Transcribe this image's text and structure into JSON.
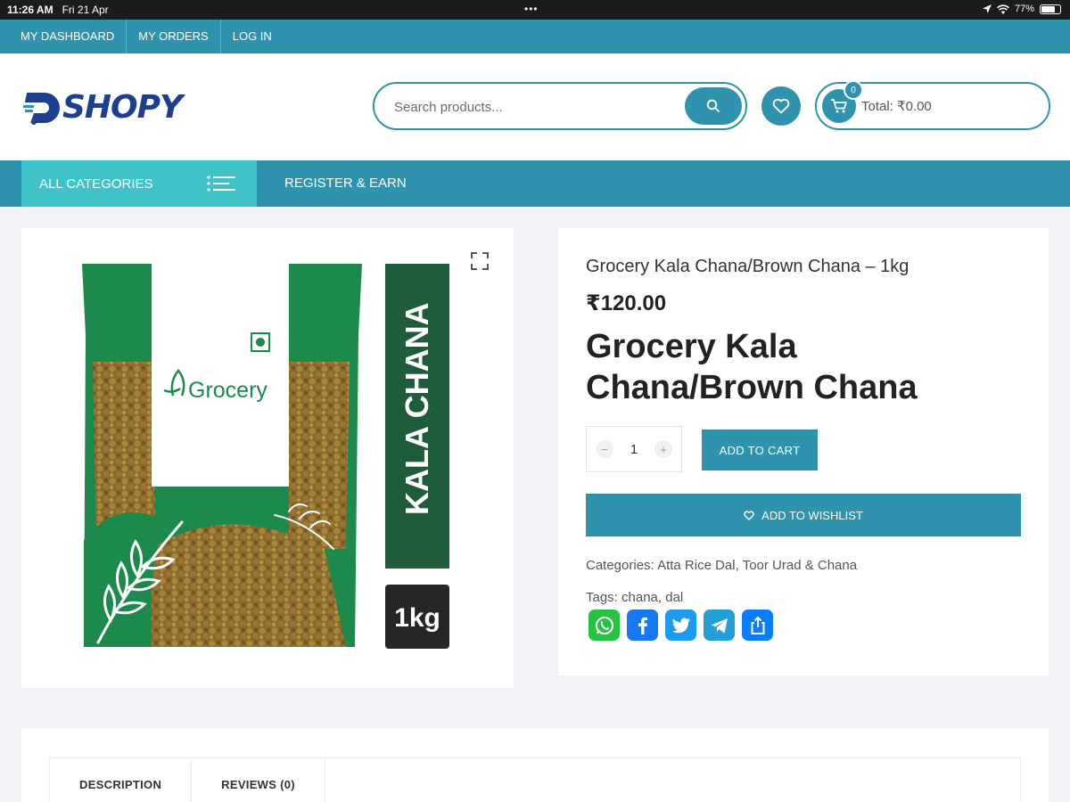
{
  "status_bar": {
    "time": "11:26 AM",
    "date": "Fri 21 Apr",
    "battery": "77%",
    "battery_level": 0.77,
    "dots": "•••"
  },
  "top_links": [
    "MY DASHBOARD",
    "MY ORDERS",
    "LOG IN"
  ],
  "brand": {
    "name": "SHOPY",
    "color": "#1e3f8f"
  },
  "search": {
    "placeholder": "Search products..."
  },
  "cart": {
    "count": "0",
    "total": "Total: ₹0.00"
  },
  "nav": {
    "all_categories": "ALL CATEGORIES",
    "register": "REGISTER & EARN"
  },
  "product_image": {
    "brand": "Grocery",
    "side_label": "KALA CHANA",
    "weight": "1kg"
  },
  "product": {
    "heading": "Grocery Kala Chana/Brown Chana – 1kg",
    "price": "₹120.00",
    "title": "Grocery Kala Chana/Brown Chana",
    "quantity": "1",
    "qty_minus": "−",
    "qty_plus": "+",
    "add_to_cart": "ADD TO CART",
    "add_to_wishlist": "ADD TO WISHLIST",
    "categories_label": "Categories:",
    "categories": [
      "Atta Rice Dal",
      "Toor Urad & Chana"
    ],
    "categories_sep": ", ",
    "tags_label": "Tags:",
    "tags": [
      "chana",
      "dal"
    ],
    "tags_sep": ", "
  },
  "share_icons": [
    "whatsapp-icon",
    "facebook-icon",
    "twitter-icon",
    "telegram-icon",
    "share-icon"
  ],
  "tabs": [
    "DESCRIPTION",
    "REVIEWS (0)"
  ],
  "colors": {
    "primary": "#2f93ad",
    "accent": "#3fc3c8",
    "package_green": "#1b8a4c",
    "dark_label": "#1f5c3a"
  }
}
